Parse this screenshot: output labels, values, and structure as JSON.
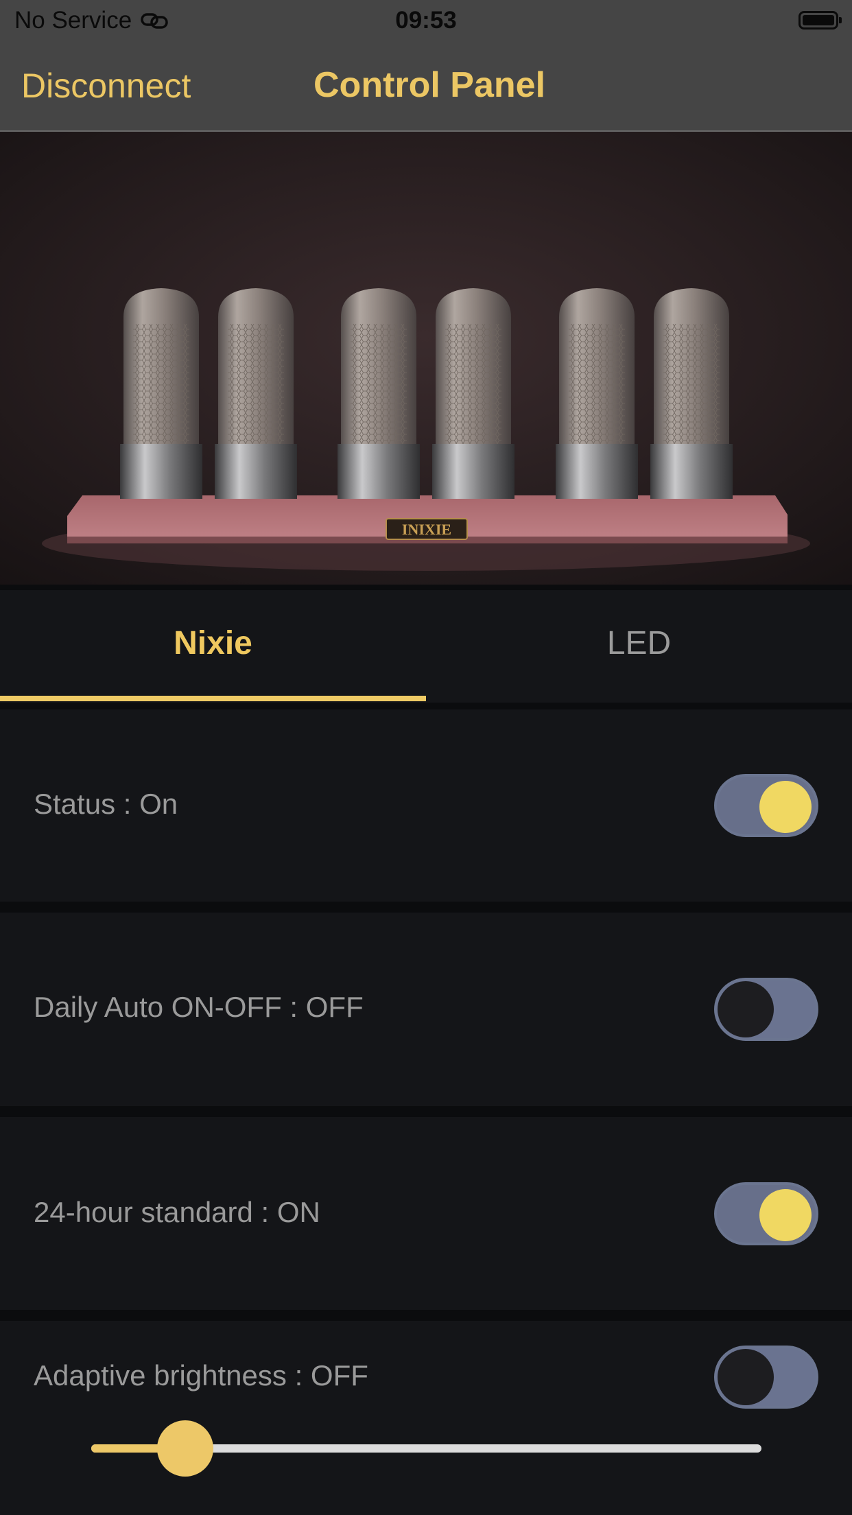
{
  "status_bar": {
    "carrier": "No Service",
    "time": "09:53",
    "icons": [
      "link-icon",
      "battery-icon"
    ]
  },
  "nav": {
    "left_button": "Disconnect",
    "title": "Control Panel"
  },
  "hero": {
    "badge_text": "INIXIE"
  },
  "tabs": [
    {
      "label": "Nixie",
      "selected": true
    },
    {
      "label": "LED",
      "selected": false
    }
  ],
  "settings": [
    {
      "label": "Status : On",
      "on": true
    },
    {
      "label": "Daily Auto ON-OFF : OFF",
      "on": false
    },
    {
      "label": "24-hour standard : ON",
      "on": true
    },
    {
      "label": "Adaptive brightness : OFF",
      "on": false
    }
  ],
  "brightness": {
    "value": 0.14
  },
  "colors": {
    "accent": "#efc85f",
    "background": "#141518",
    "bar": "#454545"
  }
}
